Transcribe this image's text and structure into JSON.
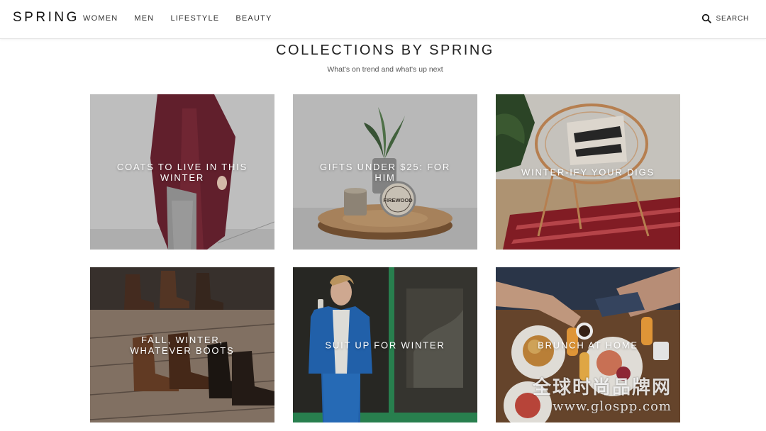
{
  "header": {
    "logo": "SPRING",
    "nav": [
      "WOMEN",
      "MEN",
      "LIFESTYLE",
      "BEAUTY"
    ],
    "search_label": "SEARCH"
  },
  "main": {
    "title": "COLLECTIONS BY SPRING",
    "subtitle": "What's on trend and what's up next",
    "collections": [
      {
        "label": "COATS TO LIVE IN THIS WINTER"
      },
      {
        "label": "GIFTS UNDER $25: FOR HIM"
      },
      {
        "label": "WINTER-IFY YOUR DIGS"
      },
      {
        "label": "FALL, WINTER, WHATEVER BOOTS"
      },
      {
        "label": "SUIT UP FOR WINTER"
      },
      {
        "label": "BRUNCH AT HOME"
      }
    ]
  },
  "product_text": {
    "candle_label": "FIREWOOD"
  },
  "watermark": {
    "chinese": "全球时尚品牌网",
    "url": "www.glospp.com"
  },
  "colors": {
    "text": "#222222",
    "overlay_text": "#ffffff",
    "divider": "#e4e4e4"
  }
}
